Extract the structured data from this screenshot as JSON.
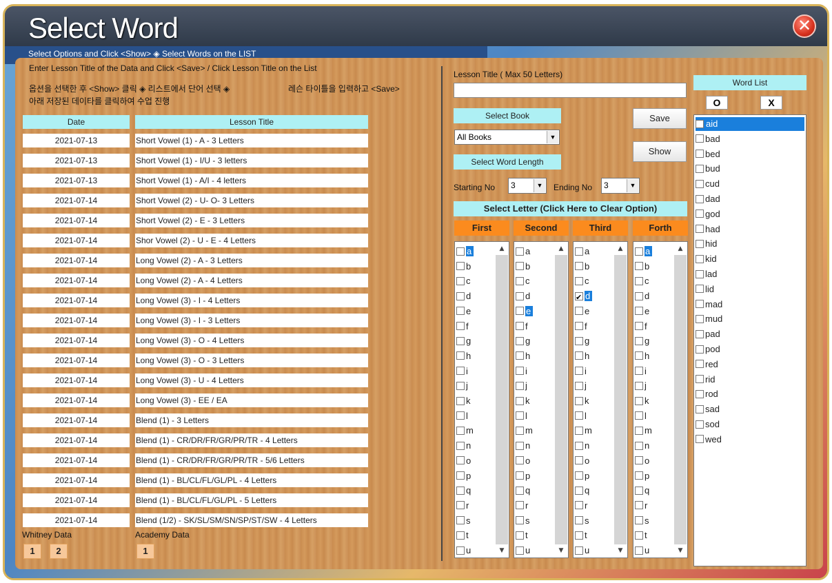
{
  "window": {
    "title": "Select Word",
    "subtitle": "Select Options and Click <Show> ◈ Select Words on the LIST",
    "close_label": "✕"
  },
  "left": {
    "instruction_en": "Enter Lesson Title of the Data and Click <Save> / Click Lesson Title on the List",
    "instruction_ko_1": "옵션을 선택한 후 <Show> 클릭 ◈ 리스트에서 단어 선택 ◈",
    "instruction_ko_2": "레슨 타이틀을 입력하고 <Save>",
    "instruction_ko_3": "아래 저장된 데이타를 클릭하여 수업 진행",
    "col_date": "Date",
    "col_title": "Lesson Title",
    "rows": [
      {
        "date": "2021-07-13",
        "title": "Short Vowel (1) - A - 3 Letters"
      },
      {
        "date": "2021-07-13",
        "title": "Short Vowel (1) - I/U - 3 letters"
      },
      {
        "date": "2021-07-13",
        "title": "Short Vowel (1)  - A/I - 4 letters"
      },
      {
        "date": "2021-07-14",
        "title": "Short Vowel (2) - U- O- 3 Letters"
      },
      {
        "date": "2021-07-14",
        "title": "Short Vowel (2) - E - 3 Letters"
      },
      {
        "date": "2021-07-14",
        "title": "Shor Vowel (2) - U - E - 4 Letters"
      },
      {
        "date": "2021-07-14",
        "title": "Long Vowel (2) - A - 3 Letters"
      },
      {
        "date": "2021-07-14",
        "title": "Long Vowel (2) - A - 4 Letters"
      },
      {
        "date": "2021-07-14",
        "title": "Long Vowel (3) - I - 4 Letters"
      },
      {
        "date": "2021-07-14",
        "title": "Long Vowel (3) - I - 3 Letters"
      },
      {
        "date": "2021-07-14",
        "title": "Long Vowel (3) - O - 4 Letters"
      },
      {
        "date": "2021-07-14",
        "title": "Long Vowel (3) - O - 3 Letters"
      },
      {
        "date": "2021-07-14",
        "title": "Long Vowel (3) - U - 4 Letters"
      },
      {
        "date": "2021-07-14",
        "title": "Long Vowel (3) -  EE / EA"
      },
      {
        "date": "2021-07-14",
        "title": "Blend (1) - 3 Letters"
      },
      {
        "date": "2021-07-14",
        "title": "Blend (1) -  CR/DR/FR/GR/PR/TR -  4 Letters"
      },
      {
        "date": "2021-07-14",
        "title": "Blend (1) -  CR/DR/FR/GR/PR/TR -  5/6 Letters"
      },
      {
        "date": "2021-07-14",
        "title": "Blend (1) - BL/CL/FL/GL/PL - 4 Letters"
      },
      {
        "date": "2021-07-14",
        "title": "Blend (1) - BL/CL/FL/GL/PL - 5 Letters"
      },
      {
        "date": "2021-07-14",
        "title": "Blend (1/2) - SK/SL/SM/SN/SP/ST/SW - 4 Letters"
      }
    ],
    "whitney_label": "Whitney Data",
    "whitney_pages": [
      "1",
      "2"
    ],
    "academy_label": "Academy Data",
    "academy_pages": [
      "1"
    ]
  },
  "middle": {
    "lesson_title_label": "Lesson Title ( Max 50 Letters)",
    "lesson_title_value": "",
    "select_book_label": "Select Book",
    "book_value": "All Books",
    "save_label": "Save",
    "show_label": "Show",
    "word_length_label": "Select Word Length",
    "starting_label": "Starting No",
    "starting_value": "3",
    "ending_label": "Ending No",
    "ending_value": "3",
    "select_letter_label": "Select Letter (Click Here to Clear Option)",
    "columns": [
      "First",
      "Second",
      "Third",
      "Forth"
    ],
    "letters": [
      "a",
      "b",
      "c",
      "d",
      "e",
      "f",
      "g",
      "h",
      "i",
      "j",
      "k",
      "l",
      "m",
      "n",
      "o",
      "p",
      "q",
      "r",
      "s",
      "t",
      "u"
    ],
    "selected": {
      "First": "a",
      "Second": "e",
      "Third": "d",
      "Forth": "a"
    },
    "checked": {
      "Third": "d"
    }
  },
  "wordlist": {
    "label": "Word List",
    "btn_o": "O",
    "btn_x": "X",
    "words": [
      "aid",
      "bad",
      "bed",
      "bud",
      "cud",
      "dad",
      "god",
      "had",
      "hid",
      "kid",
      "lad",
      "lid",
      "mad",
      "mud",
      "pad",
      "pod",
      "red",
      "rid",
      "rod",
      "sad",
      "sod",
      "wed"
    ],
    "selected": "aid"
  }
}
